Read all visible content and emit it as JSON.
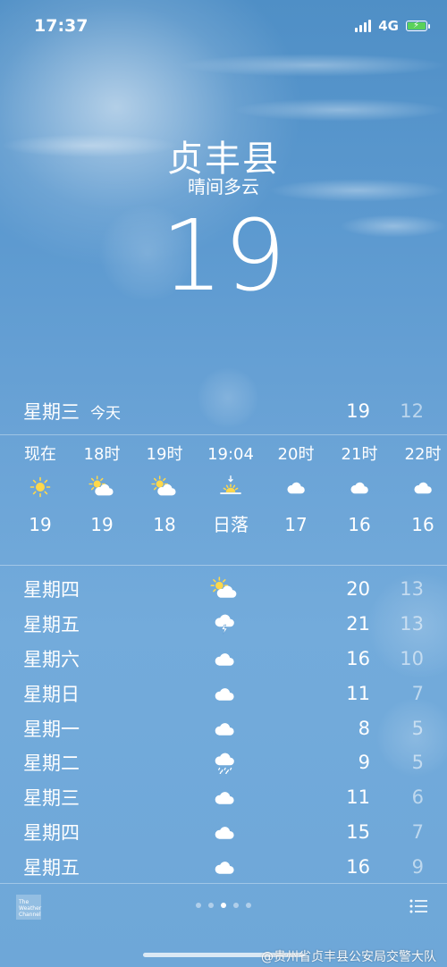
{
  "status_bar": {
    "time": "17:37",
    "network": "4G"
  },
  "location": {
    "city": "贞丰县",
    "condition": "晴间多云",
    "temperature": "19"
  },
  "today": {
    "day": "星期三",
    "label": "今天",
    "high": "19",
    "low": "12"
  },
  "hourly": [
    {
      "time": "现在",
      "icon": "sun-icon",
      "temp": "19"
    },
    {
      "time": "18时",
      "icon": "partly-cloudy-icon",
      "temp": "19"
    },
    {
      "time": "19时",
      "icon": "partly-cloudy-icon",
      "temp": "18"
    },
    {
      "time": "19:04",
      "icon": "sunset-icon",
      "temp": "日落"
    },
    {
      "time": "20时",
      "icon": "cloud-icon",
      "temp": "17"
    },
    {
      "time": "21时",
      "icon": "cloud-icon",
      "temp": "16"
    },
    {
      "time": "22时",
      "icon": "cloud-icon",
      "temp": "16"
    }
  ],
  "daily": [
    {
      "day": "星期四",
      "icon": "partly-cloudy-icon",
      "high": "20",
      "low": "13"
    },
    {
      "day": "星期五",
      "icon": "thunderstorm-icon",
      "high": "21",
      "low": "13"
    },
    {
      "day": "星期六",
      "icon": "cloud-icon",
      "high": "16",
      "low": "10"
    },
    {
      "day": "星期日",
      "icon": "cloud-icon",
      "high": "11",
      "low": "7"
    },
    {
      "day": "星期一",
      "icon": "cloud-icon",
      "high": "8",
      "low": "5"
    },
    {
      "day": "星期二",
      "icon": "rain-icon",
      "high": "9",
      "low": "5"
    },
    {
      "day": "星期三",
      "icon": "cloud-icon",
      "high": "11",
      "low": "6"
    },
    {
      "day": "星期四",
      "icon": "cloud-icon",
      "high": "15",
      "low": "7"
    },
    {
      "day": "星期五",
      "icon": "cloud-icon",
      "high": "16",
      "low": "9"
    }
  ],
  "footer": {
    "logo_text": [
      "The",
      "Weather",
      "Channel"
    ],
    "page_count": 5,
    "active_page": 3,
    "watermark": "@贵州省贞丰县公安局交警大队"
  },
  "colors": {
    "sun": "#ffd84a",
    "battery": "#5ad15a"
  }
}
